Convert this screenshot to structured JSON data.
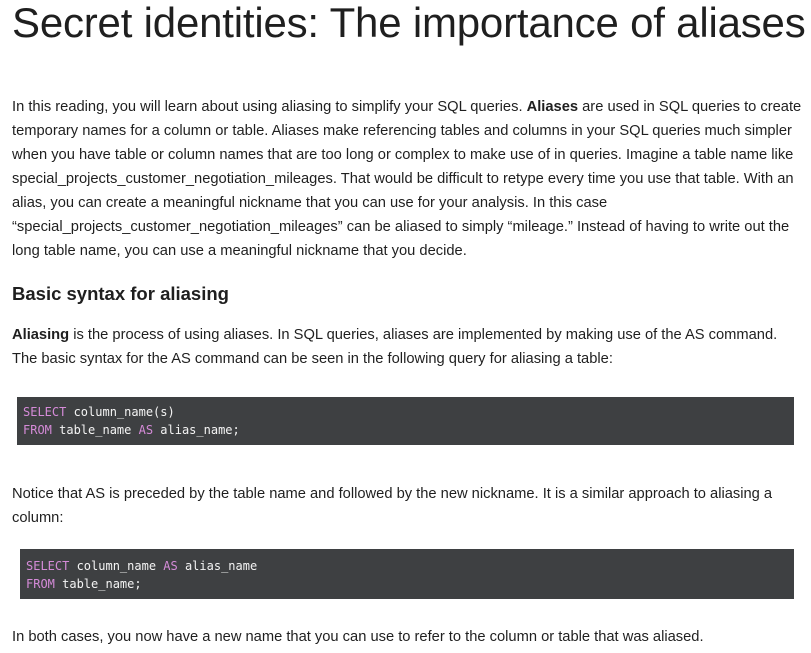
{
  "title": "Secret identities: The importance of aliases",
  "intro": {
    "text_before": "In this reading, you will learn about using aliasing to simplify your SQL queries. ",
    "bold": "Aliases",
    "text_after": " are used in SQL queries to create temporary names for a column or table. Aliases make referencing tables and columns in your SQL queries much simpler when you have table or column names that are too long or complex to make use of in queries. Imagine a table name like special_projects_customer_negotiation_mileages. That would be difficult to retype every time you use that table. With an alias, you can create a meaningful nickname that you can use for your analysis. In this case “special_projects_customer_negotiation_mileages” can be aliased to simply “mileage.” Instead of having to write out the long table name, you can use a meaningful nickname that you decide."
  },
  "section": {
    "heading": "Basic syntax for aliasing",
    "aliasing_bold": "Aliasing",
    "aliasing_text": " is the process of using aliases. In SQL queries, aliases are implemented by making use of the AS command. The basic syntax for the AS command can be seen in the following query for aliasing a table:"
  },
  "code_table": {
    "line1_kw": "SELECT",
    "line1_rest": " column_name(s)",
    "line2_kw": "FROM",
    "line2_mid": " table_name ",
    "line2_kw2": "AS",
    "line2_rest": " alias_name;"
  },
  "notice": "Notice that AS is preceded by the table name and followed by the new nickname. It is a similar approach to aliasing a column:",
  "code_column": {
    "line1_kw": "SELECT",
    "line1_mid": " column_name ",
    "line1_kw2": "AS",
    "line1_rest": " alias_name",
    "line2_kw": "FROM",
    "line2_rest": " table_name;"
  },
  "both_cases": "In both cases, you now have a new name that you can use to refer to the column or table that was aliased.",
  "colors": {
    "code_background": "#3e4042",
    "keyword": "#d58bd8",
    "code_text": "#f4f4f4",
    "body_text": "#1f1f1f"
  }
}
